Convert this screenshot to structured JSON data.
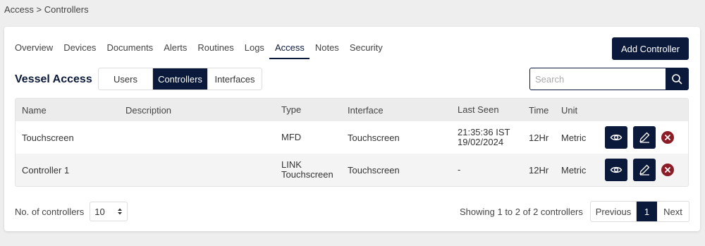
{
  "breadcrumb": "Access > Controllers",
  "tabs": [
    {
      "label": "Overview"
    },
    {
      "label": "Devices"
    },
    {
      "label": "Documents"
    },
    {
      "label": "Alerts"
    },
    {
      "label": "Routines"
    },
    {
      "label": "Logs"
    },
    {
      "label": "Access"
    },
    {
      "label": "Notes"
    },
    {
      "label": "Security"
    }
  ],
  "active_tab": "Access",
  "add_button": "Add Controller",
  "title": "Vessel Access",
  "segments": [
    "Users",
    "Controllers",
    "Interfaces"
  ],
  "active_segment": "Controllers",
  "search": {
    "placeholder": "Search",
    "icon": "search-icon"
  },
  "table": {
    "headers": [
      "Name",
      "Description",
      "Type",
      "Interface",
      "Last Seen",
      "Time",
      "Unit"
    ],
    "rows": [
      {
        "name": "Touchscreen",
        "description": "",
        "type": "MFD",
        "interface": "Touchscreen",
        "last_seen": "21:35:36 IST 19/02/2024",
        "time": "12Hr",
        "unit": "Metric"
      },
      {
        "name": "Controller 1",
        "description": "",
        "type": "LINK Touchscreen",
        "interface": "Touchscreen",
        "last_seen": "-",
        "time": "12Hr",
        "unit": "Metric"
      }
    ],
    "row_actions": [
      "eye-icon",
      "pencil-icon",
      "delete-icon"
    ]
  },
  "footer": {
    "count_label": "No. of controllers",
    "page_size": "10",
    "showing": "Showing 1 to 2 of 2 controllers",
    "prev": "Previous",
    "current_page": "1",
    "next": "Next"
  },
  "colors": {
    "primary": "#0b1a3a",
    "delete": "#8c1c26"
  }
}
